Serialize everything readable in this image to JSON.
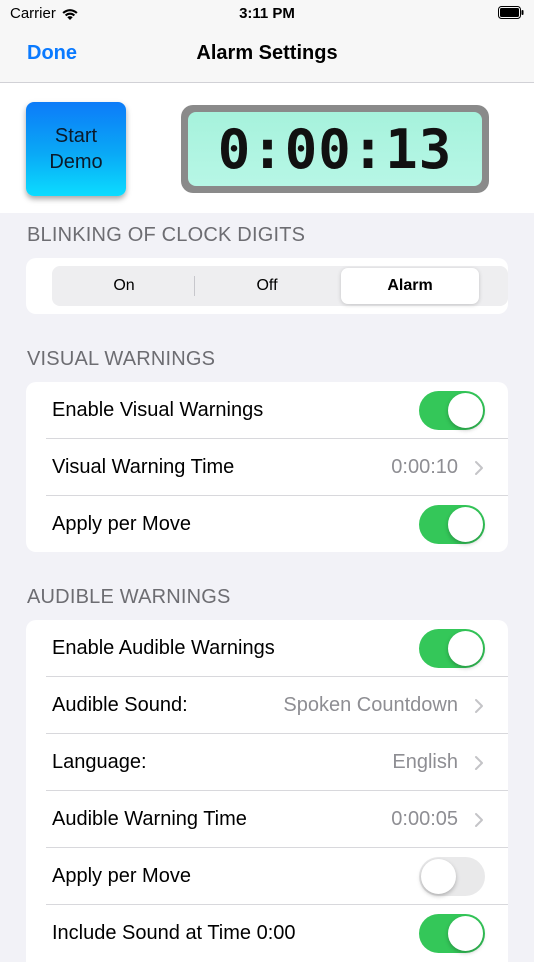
{
  "status_bar": {
    "carrier": "Carrier",
    "time": "3:11 PM",
    "wifi_icon": "wifi-icon",
    "battery_icon": "battery-icon"
  },
  "nav": {
    "done_label": "Done",
    "title": "Alarm Settings"
  },
  "demo_button": {
    "line1": "Start",
    "line2": "Demo"
  },
  "clock": {
    "display": "0:00:13"
  },
  "blinking": {
    "header": "BLINKING OF CLOCK DIGITS",
    "options": [
      "On",
      "Off",
      "Alarm"
    ],
    "selected": "Alarm"
  },
  "visual_warnings": {
    "header": "VISUAL WARNINGS",
    "rows": [
      {
        "label": "Enable Visual Warnings",
        "type": "toggle",
        "on": true
      },
      {
        "label": "Visual Warning Time",
        "type": "value",
        "value": "0:00:10"
      },
      {
        "label": "Apply per Move",
        "type": "toggle",
        "on": true
      }
    ]
  },
  "audible_warnings": {
    "header": "AUDIBLE WARNINGS",
    "rows": [
      {
        "label": "Enable Audible Warnings",
        "type": "toggle",
        "on": true
      },
      {
        "label": "Audible Sound:",
        "type": "value",
        "value": "Spoken Countdown"
      },
      {
        "label": "Language:",
        "type": "value",
        "value": "English"
      },
      {
        "label": "Audible Warning Time",
        "type": "value",
        "value": "0:00:05"
      },
      {
        "label": "Apply per Move",
        "type": "toggle",
        "on": false
      },
      {
        "label": "Include Sound at Time 0:00",
        "type": "toggle",
        "on": true
      }
    ]
  },
  "colors": {
    "accent": "#0a7aff",
    "toggle_on": "#34c759",
    "toggle_off": "#e9e9ea",
    "clock_face": "#b7f7e6"
  }
}
